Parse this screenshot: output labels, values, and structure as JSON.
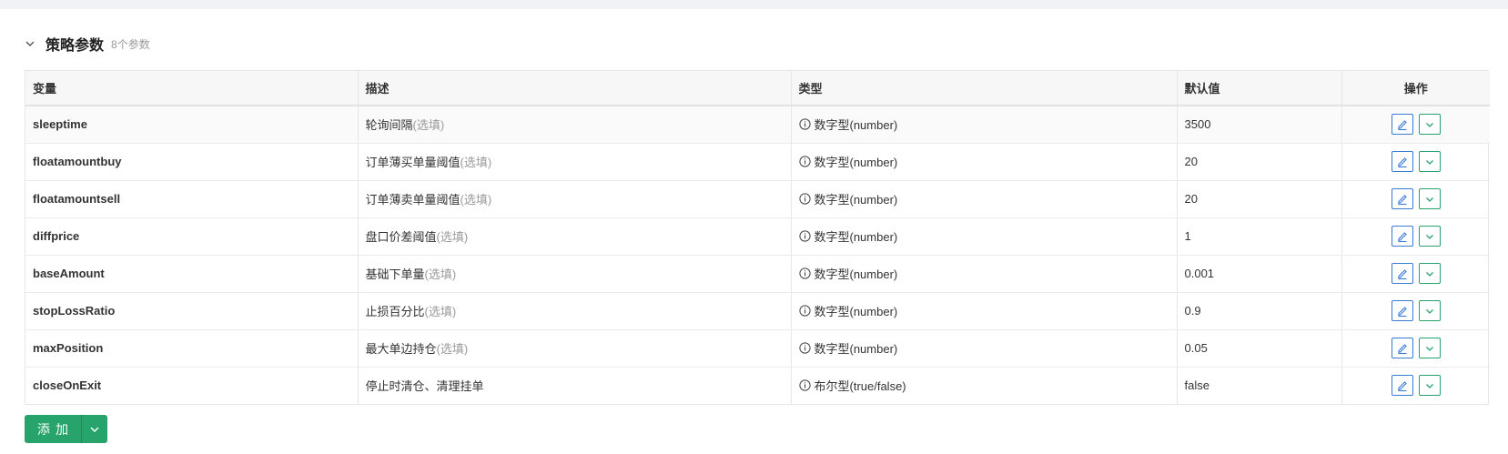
{
  "section": {
    "title": "策略参数",
    "count": "8个参数",
    "collapse_icon": "chevron-down-icon"
  },
  "table": {
    "columns": [
      "变量",
      "描述",
      "类型",
      "默认值",
      "操作"
    ],
    "rows": [
      {
        "name": "sleeptime",
        "desc": "轮询间隔",
        "optional": "(选填)",
        "type": "数字型(number)",
        "default": "3500"
      },
      {
        "name": "floatamountbuy",
        "desc": "订单薄买单量阈值",
        "optional": "(选填)",
        "type": "数字型(number)",
        "default": "20"
      },
      {
        "name": "floatamountsell",
        "desc": "订单薄卖单量阈值",
        "optional": "(选填)",
        "type": "数字型(number)",
        "default": "20"
      },
      {
        "name": "diffprice",
        "desc": "盘口价差阈值",
        "optional": "(选填)",
        "type": "数字型(number)",
        "default": "1"
      },
      {
        "name": "baseAmount",
        "desc": "基础下单量",
        "optional": "(选填)",
        "type": "数字型(number)",
        "default": "0.001"
      },
      {
        "name": "stopLossRatio",
        "desc": "止损百分比",
        "optional": "(选填)",
        "type": "数字型(number)",
        "default": "0.9"
      },
      {
        "name": "maxPosition",
        "desc": "最大单边持仓",
        "optional": "(选填)",
        "type": "数字型(number)",
        "default": "0.05"
      },
      {
        "name": "closeOnExit",
        "desc": "停止时清仓、清理挂单",
        "optional": "",
        "type": "布尔型(true/false)",
        "default": "false"
      }
    ]
  },
  "add_button": {
    "label": "添加",
    "dropdown_icon": "chevron-down-icon"
  },
  "colors": {
    "edit_blue": "#3a7bd5",
    "action_green": "#27a36c",
    "optional_gray": "#9a9a9a"
  }
}
